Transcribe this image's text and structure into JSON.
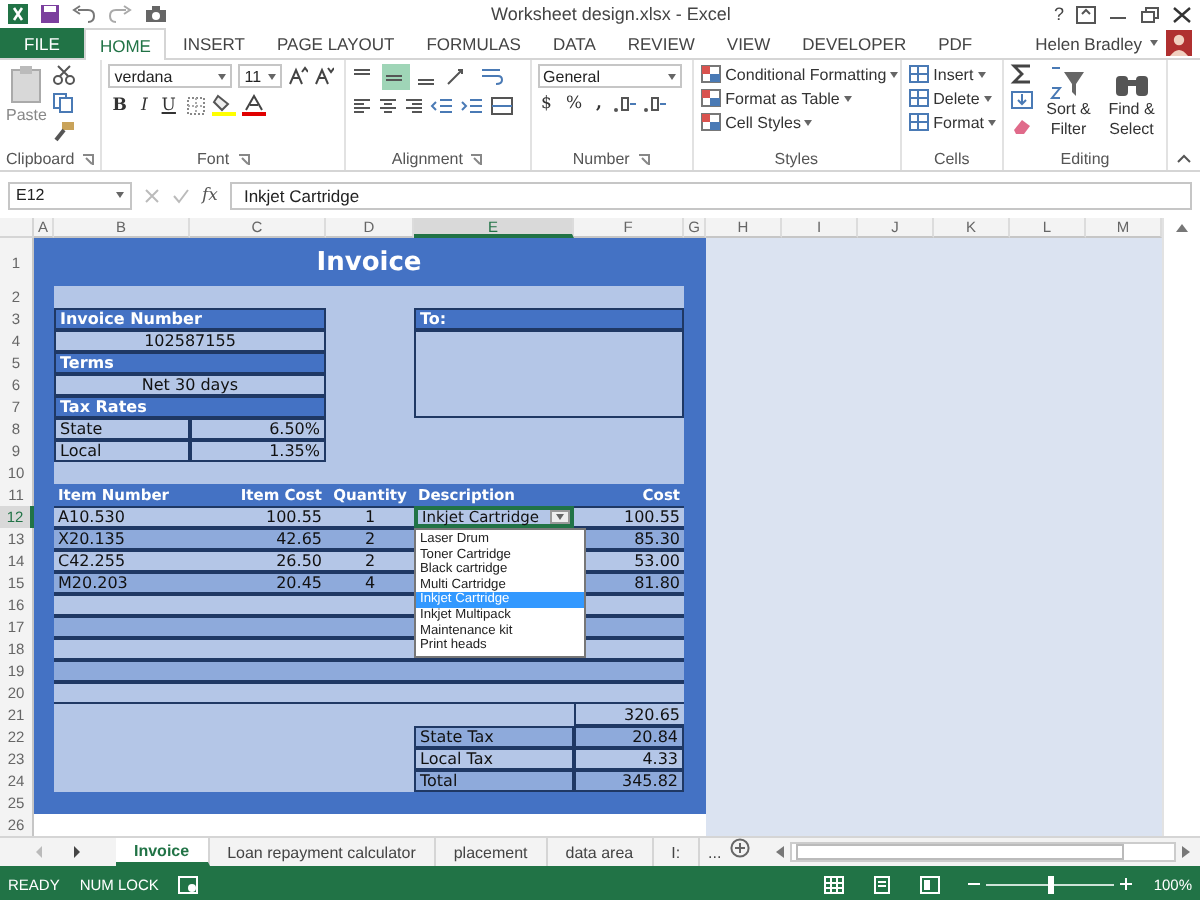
{
  "title_bar": {
    "title": "Worksheet design.xlsx - Excel",
    "help": "?"
  },
  "ribbon_tabs": [
    {
      "label": "FILE",
      "kind": "file",
      "selected": false
    },
    {
      "label": "HOME",
      "kind": "tab",
      "selected": true
    },
    {
      "label": "INSERT",
      "kind": "tab",
      "selected": false
    },
    {
      "label": "PAGE LAYOUT",
      "kind": "tab",
      "selected": false
    },
    {
      "label": "FORMULAS",
      "kind": "tab",
      "selected": false
    },
    {
      "label": "DATA",
      "kind": "tab",
      "selected": false
    },
    {
      "label": "REVIEW",
      "kind": "tab",
      "selected": false
    },
    {
      "label": "VIEW",
      "kind": "tab",
      "selected": false
    },
    {
      "label": "DEVELOPER",
      "kind": "tab",
      "selected": false
    },
    {
      "label": "PDF",
      "kind": "tab",
      "selected": false
    }
  ],
  "user": {
    "name": "Helen Bradley"
  },
  "ribbon": {
    "groups": [
      {
        "kind": "clipboard",
        "label": "Clipboard",
        "paste": "Paste"
      },
      {
        "kind": "font",
        "label": "Font",
        "font_name": "verdana",
        "font_size": "11",
        "bold": "B",
        "italic": "I",
        "underline": "U"
      },
      {
        "kind": "alignment",
        "label": "Alignment",
        "middle_align_selected": true
      },
      {
        "kind": "number",
        "label": "Number",
        "format": "General",
        "currency": "$",
        "percent": "%",
        "comma": ","
      },
      {
        "kind": "styles",
        "label": "Styles",
        "commands": [
          "Conditional Formatting",
          "Format as Table",
          "Cell Styles"
        ]
      },
      {
        "kind": "cells",
        "label": "Cells",
        "commands": [
          "Insert",
          "Delete",
          "Format"
        ]
      },
      {
        "kind": "editing",
        "label": "Editing",
        "commands": [
          "Sort & Filter",
          "Find & Select"
        ]
      }
    ]
  },
  "formula_bar": {
    "name_box": "E12",
    "function_label": "fx",
    "content": "Inkjet Cartridge"
  },
  "column_headers": [
    {
      "label": "A",
      "selected": false
    },
    {
      "label": "B",
      "selected": false
    },
    {
      "label": "C",
      "selected": false
    },
    {
      "label": "D",
      "selected": false
    },
    {
      "label": "E",
      "selected": true
    },
    {
      "label": "F",
      "selected": false
    },
    {
      "label": "G",
      "selected": false
    },
    {
      "label": "H",
      "selected": false
    },
    {
      "label": "I",
      "selected": false
    },
    {
      "label": "J",
      "selected": false
    },
    {
      "label": "K",
      "selected": false
    },
    {
      "label": "L",
      "selected": false
    },
    {
      "label": "M",
      "selected": false
    }
  ],
  "row_headers": [
    {
      "label": "1",
      "selected": false
    },
    {
      "label": "2",
      "selected": false
    },
    {
      "label": "3",
      "selected": false
    },
    {
      "label": "4",
      "selected": false
    },
    {
      "label": "5",
      "selected": false
    },
    {
      "label": "6",
      "selected": false
    },
    {
      "label": "7",
      "selected": false
    },
    {
      "label": "8",
      "selected": false
    },
    {
      "label": "9",
      "selected": false
    },
    {
      "label": "10",
      "selected": false
    },
    {
      "label": "11",
      "selected": false
    },
    {
      "label": "12",
      "selected": true
    },
    {
      "label": "13",
      "selected": false
    },
    {
      "label": "14",
      "selected": false
    },
    {
      "label": "15",
      "selected": false
    },
    {
      "label": "16",
      "selected": false
    },
    {
      "label": "17",
      "selected": false
    },
    {
      "label": "18",
      "selected": false
    },
    {
      "label": "19",
      "selected": false
    },
    {
      "label": "20",
      "selected": false
    },
    {
      "label": "21",
      "selected": false
    },
    {
      "label": "22",
      "selected": false
    },
    {
      "label": "23",
      "selected": false
    },
    {
      "label": "24",
      "selected": false
    },
    {
      "label": "25",
      "selected": false
    },
    {
      "label": "26",
      "selected": false
    }
  ],
  "invoice": {
    "title": "Invoice",
    "fields": [
      {
        "label": "Invoice Number",
        "value": "102587155"
      },
      {
        "label": "Terms",
        "value": "Net 30 days"
      }
    ],
    "tax_rates": {
      "label": "Tax Rates",
      "rows": [
        {
          "name": "State",
          "rate": "6.50%"
        },
        {
          "name": "Local",
          "rate": "1.35%"
        }
      ]
    },
    "to": {
      "label": "To:"
    },
    "items": {
      "columns": [
        "Item Number",
        "Item Cost",
        "Quantity",
        "Description",
        "Cost"
      ],
      "rows": [
        {
          "item_number": "A10.530",
          "item_cost": "100.55",
          "quantity": "1",
          "description": "Inkjet Cartridge",
          "cost": "100.55",
          "selected": true
        },
        {
          "item_number": "X20.135",
          "item_cost": "42.65",
          "quantity": "2",
          "cost": "85.30",
          "selected": false
        },
        {
          "item_number": "C42.255",
          "item_cost": "26.50",
          "quantity": "2",
          "cost": "53.00",
          "selected": false
        },
        {
          "item_number": "M20.203",
          "item_cost": "20.45",
          "quantity": "4",
          "cost": "81.80",
          "selected": false
        }
      ]
    },
    "subtotal": "320.65",
    "totals": [
      {
        "label": "State Tax",
        "value": "20.84"
      },
      {
        "label": "Local Tax",
        "value": "4.33"
      },
      {
        "label": "Total",
        "value": "345.82"
      }
    ]
  },
  "dropdown": {
    "options": [
      {
        "label": "Laser Drum",
        "selected": false
      },
      {
        "label": "Toner Cartridge",
        "selected": false
      },
      {
        "label": "Black cartridge",
        "selected": false
      },
      {
        "label": "Multi Cartridge",
        "selected": false
      },
      {
        "label": "Inkjet Cartridge",
        "selected": true
      },
      {
        "label": "Inkjet Multipack",
        "selected": false
      },
      {
        "label": "Maintenance kit",
        "selected": false
      },
      {
        "label": "Print heads",
        "selected": false
      }
    ]
  },
  "sheet_tabs": [
    {
      "label": "Invoice",
      "selected": true
    },
    {
      "label": "Loan repayment calculator",
      "selected": false
    },
    {
      "label": "placement",
      "selected": false
    },
    {
      "label": "data area",
      "selected": false
    },
    {
      "label": "I:",
      "selected": false
    }
  ],
  "more_tabs": "...",
  "status_bar": {
    "mode": "READY",
    "indicator": "NUM LOCK",
    "zoom": {
      "level": 0.5,
      "label": "100%"
    }
  }
}
